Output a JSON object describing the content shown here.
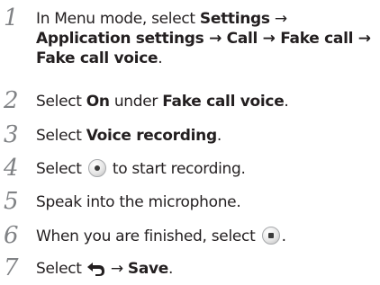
{
  "steps": [
    {
      "number": "1",
      "line1_prefix": "In Menu mode, select ",
      "line1_bold": "Settings",
      "arrow": "→",
      "line2": "Application settings → Call → Fake call →",
      "line3": "Fake call voice",
      "line3_suffix": "."
    },
    {
      "number": "2",
      "prefix": "Select ",
      "bold1": "On",
      "middle": " under ",
      "bold2": "Fake call voice",
      "suffix": "."
    },
    {
      "number": "3",
      "prefix": "Select ",
      "bold1": "Voice recording",
      "suffix": "."
    },
    {
      "number": "4",
      "prefix": "Select ",
      "icon": "record-icon",
      "suffix": " to start recording."
    },
    {
      "number": "5",
      "text": "Speak into the microphone."
    },
    {
      "number": "6",
      "prefix": "When you are finished, select ",
      "icon": "stop-icon",
      "suffix": "."
    },
    {
      "number": "7",
      "prefix": "Select ",
      "icon": "back-icon",
      "arrow": " → ",
      "bold1": "Save",
      "suffix": "."
    }
  ]
}
